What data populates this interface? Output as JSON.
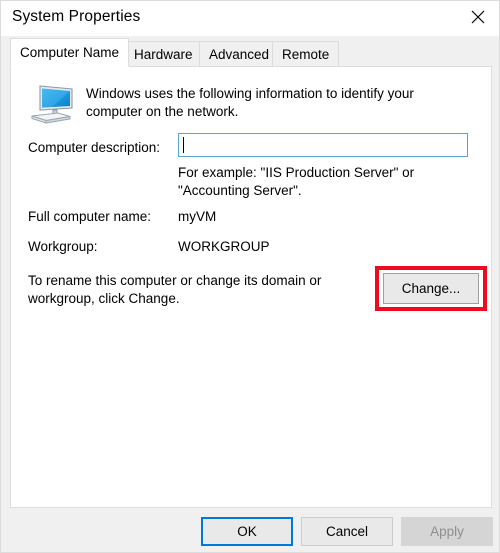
{
  "window": {
    "title": "System Properties",
    "close_icon": "close-x-icon"
  },
  "tabs": [
    {
      "label": "Computer Name",
      "active": true
    },
    {
      "label": "Hardware",
      "active": false
    },
    {
      "label": "Advanced",
      "active": false
    },
    {
      "label": "Remote",
      "active": false
    }
  ],
  "content": {
    "icon_name": "computer-monitor-icon",
    "intro": "Windows uses the following information to identify your computer on the network.",
    "description_label": "Computer description:",
    "description_value": "",
    "description_placeholder": "",
    "example_hint": "For example: \"IIS Production Server\" or \"Accounting Server\".",
    "full_name_label": "Full computer name:",
    "full_name_value": "myVM",
    "workgroup_label": "Workgroup:",
    "workgroup_value": "WORKGROUP",
    "rename_text": "To rename this computer or change its domain or workgroup, click Change.",
    "change_button": "Change...",
    "highlight_color": "#ef0a22"
  },
  "footer": {
    "ok": "OK",
    "cancel": "Cancel",
    "apply": "Apply",
    "focus_color": "#0078d7"
  }
}
